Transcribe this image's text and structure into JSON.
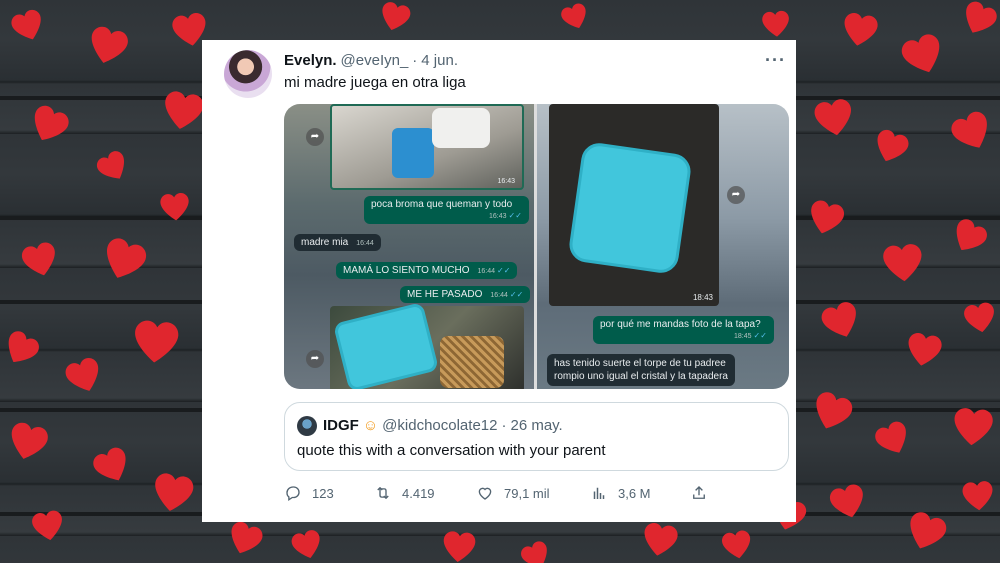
{
  "tweet": {
    "display_name": "Evelyn.",
    "handle": "@eveIyn_",
    "separator": "·",
    "date": "4 jun.",
    "more_icon": "more-icon",
    "text": "mi madre juega en otra liga"
  },
  "chat_left": {
    "messages": [
      {
        "text": "poca broma que queman y todo",
        "time": "16:43",
        "ticks": "✓✓"
      },
      {
        "text": "madre mia",
        "time": "16:44"
      },
      {
        "text": "MAMÁ LO SIENTO MUCHO",
        "time": "16:44",
        "ticks": "✓✓"
      },
      {
        "text": "ME HE PASADO",
        "time": "16:44",
        "ticks": "✓✓"
      }
    ],
    "photo_time": "16:43"
  },
  "chat_right": {
    "photo_time": "18:43",
    "messages": [
      {
        "text": "por qué me mandas foto de la tapa?",
        "time": "18:45",
        "ticks": "✓✓"
      },
      {
        "text": "has tenido suerte el torpe de tu padree"
      },
      {
        "text": "rompio uno igual el cristal y la tapadera"
      }
    ]
  },
  "quote": {
    "display_name": "IDGF",
    "emoji": "☺",
    "handle": "@kidchocolate12",
    "separator": "·",
    "date": "26 may.",
    "text": "quote this with a conversation with your parent"
  },
  "actions": {
    "replies": "123",
    "retweets": "4.419",
    "likes": "79,1 mil",
    "views": "3,6 M"
  },
  "colors": {
    "background": "#2f3438",
    "heart": "#e0262e",
    "card": "#ffffff",
    "whatsapp_out": "#005c4b",
    "whatsapp_in": "#202c33",
    "muted_text": "#536471"
  }
}
